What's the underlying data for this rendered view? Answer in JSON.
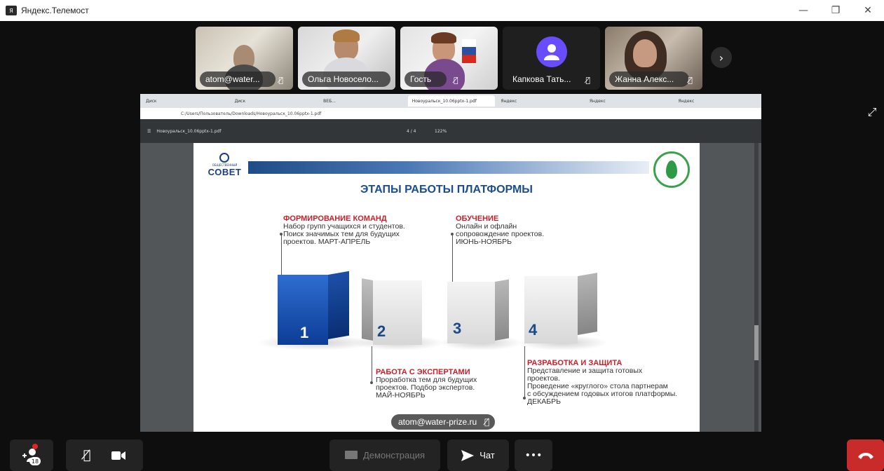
{
  "app": {
    "icon_label": "Я",
    "title": "Яндекс.Телемост",
    "window_controls": [
      "—",
      "❐",
      "✕"
    ]
  },
  "participants": [
    {
      "name": "atom@water...",
      "muted": true,
      "active": false
    },
    {
      "name": "Ольга Новосело...",
      "muted": false,
      "active": true
    },
    {
      "name": "Гость",
      "muted": true,
      "active": false
    },
    {
      "name": "Капкова Тать...",
      "muted": true,
      "active": false,
      "avatar": "person-icon"
    },
    {
      "name": "Жанна Алекс...",
      "muted": true,
      "active": false
    }
  ],
  "icons": {
    "mic_off": "🎙̸",
    "next": "›",
    "expand": "⤢"
  },
  "browser": {
    "tabs": [
      "Диск",
      "Диск",
      "ВЕБ...",
      "Новоуральск_10.06pptx-1.pdf",
      "Яндекс",
      "Яндекс",
      "Яндекс"
    ],
    "url": "C:/Users/Пользователь/Downloads/Новоуральск_10.06pptx-1.pdf"
  },
  "pdf": {
    "filename": "Новоуральск_10.06pptx-1.pdf",
    "pages": "4 / 4",
    "zoom": "122%"
  },
  "slide": {
    "logo_sub": "ОБЩЕСТВЕННЫЙ",
    "logo_word": "СОВЕТ",
    "title": "ЭТАПЫ РАБОТЫ ПЛАТФОРМЫ",
    "stages": [
      {
        "num": "1",
        "heading": "ФОРМИРОВАНИЕ КОМАНД",
        "text": "Набор групп учащихся и студентов.\nПоиск значимых тем для будущих\nпроектов. МАРТ-АПРЕЛЬ"
      },
      {
        "num": "2",
        "heading": "РАБОТА С ЭКСПЕРТАМИ",
        "text": "Проработка тем для будущих\nпроектов. Подбор экспертов.\nМАЙ-НОЯБРЬ"
      },
      {
        "num": "3",
        "heading": "ОБУЧЕНИЕ",
        "text": "Онлайн и офлайн\nсопровождение проектов.\nИЮНЬ-НОЯБРЬ"
      },
      {
        "num": "4",
        "heading": "РАЗРАБОТКА И ЗАЩИТА",
        "text": "Представление и защита готовых\nпроектов.\nПроведение «круглого» стола партнерам\nс обсуждением годовых итогов платформы.\nДЕКАБРЬ"
      }
    ]
  },
  "share_owner": "atom@water-prize.ru",
  "controls": {
    "participants_count": "18",
    "demo_label": "Демонстрация",
    "chat_label": "Чат",
    "more_label": "•••"
  },
  "colors": {
    "active_speaker": "#f5c518",
    "hangup": "#c92b2b",
    "slide_heading": "#c8202a",
    "slide_title": "#1c4d8f"
  }
}
